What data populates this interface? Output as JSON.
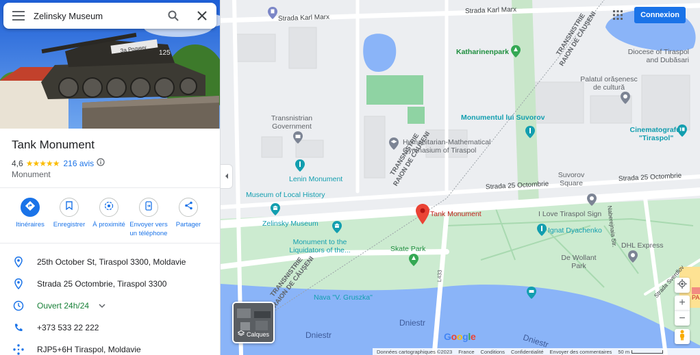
{
  "search": {
    "query": "Zelinsky Museum"
  },
  "place": {
    "title": "Tank Monument",
    "rating": "4,6",
    "stars": "★★★★★",
    "reviews": "216 avis",
    "category": "Monument"
  },
  "actions": [
    {
      "label": "Itinéraires",
      "icon": "directions-icon"
    },
    {
      "label": "Enregistrer",
      "icon": "bookmark-icon"
    },
    {
      "label": "À proximité",
      "icon": "nearby-icon"
    },
    {
      "label": "Envoyer vers un téléphone",
      "icon": "send-to-phone-icon"
    },
    {
      "label": "Partager",
      "icon": "share-icon"
    }
  ],
  "info": {
    "address": "25th October St, Tiraspol 3300, Moldavie",
    "address2": "Strada 25 Octombrie, Tiraspol 3300",
    "hours": "Ouvert 24h/24",
    "phone": "+373 533 22 222",
    "pluscode": "RJP5+6H Tiraspol, Moldavie"
  },
  "hero_sign": {
    "line1": "За Родину",
    "line2": "125"
  },
  "header": {
    "signin": "Connexion"
  },
  "map_labels": {
    "strada_karl_marx_1": "Strada Karl Marx",
    "strada_karl_marx_2": "Strada Karl Marx",
    "transnistrie_top_1": "TRANSNISTRIE",
    "transnistrie_top_2": "RAION DE CĂUȘENI",
    "katharinenpark": "Katharinenpark",
    "diocese": "Diocese of Tiraspol",
    "diocese2": "and Dubăsari",
    "palatul1": "Palatul orășenesc",
    "palatul2": "de cultură",
    "transnistrian_gov1": "Transnistrian",
    "transnistrian_gov2": "Government",
    "monumentul": "Monumentul lui Suvorov",
    "cinema1": "Cinematograful",
    "cinema2": "\"Tiraspol\"",
    "huma1": "Humanitarian-Mathematical",
    "huma2": "Gymnasium of Tiraspol",
    "transnistrie_mid_1": "TRANSNISTRIE",
    "transnistrie_mid_2": "RAION DE CĂUȘENI",
    "lenin": "Lenin Monument",
    "suvorov_sq1": "Suvorov",
    "suvorov_sq2": "Square",
    "strada_25_1": "Strada 25 Octombrie",
    "strada_25_2": "Strada 25 Octombrie",
    "museum_local": "Museum of Local History",
    "tank_monument": "Tank Monument",
    "love_tiraspol": "I Love Tiraspol Sign",
    "zelinsky": "Zelinsky Museum",
    "ignat": "Ignat Dyachenko",
    "monument_liq1": "Monument to the",
    "monument_liq2": "Liquidators of the...",
    "skate": "Skate Park",
    "dhl": "DHL Express",
    "dewollant1": "De Wollant",
    "dewollant2": "Park",
    "naberejnaia": "Naberejnaia Str.",
    "sverdlov": "Strada Sverdlov",
    "transnistrie_bot_1": "TRANSNISTRIE",
    "transnistrie_bot_2": "RAION DE CĂUȘENI",
    "nava": "Nava \"V. Gruszka\"",
    "l433": "L433",
    "dniestr1": "Dniestr",
    "dniestr2": "Dniestr",
    "dniestr3": "Dniestr",
    "pa": "PA"
  },
  "layers": {
    "label": "Calques"
  },
  "zoom": {
    "in": "+",
    "out": "−"
  },
  "logo": {
    "text": "Google"
  },
  "footer": {
    "data": "Données cartographiques ©2023",
    "country": "France",
    "conditions": "Conditions",
    "privacy": "Confidentialité",
    "feedback": "Envoyer des commentaires",
    "scale": "50 m"
  },
  "colors": {
    "accent": "#1a73e8",
    "park": "#c8e6c9",
    "water": "#8ab4f8",
    "road": "#ffffff",
    "pin": "#ea4335",
    "open": "#188038"
  }
}
